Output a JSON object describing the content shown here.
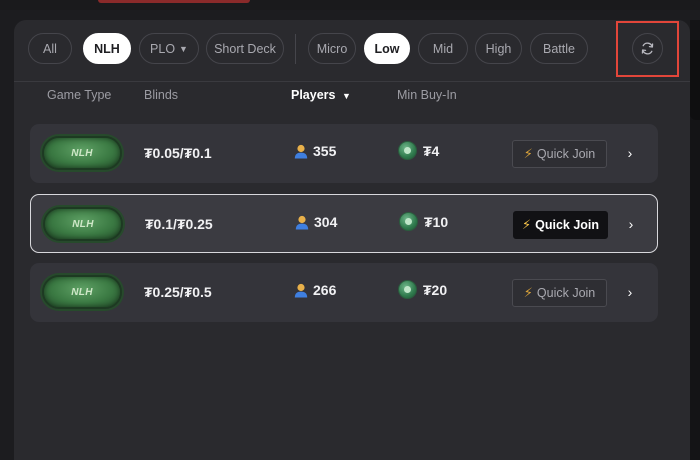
{
  "filters": {
    "game_types": [
      {
        "label": "All",
        "active": false
      },
      {
        "label": "NLH",
        "active": true
      },
      {
        "label": "PLO",
        "active": false,
        "has_dropdown": true
      },
      {
        "label": "Short Deck",
        "active": false
      }
    ],
    "stakes": [
      {
        "label": "Micro",
        "active": false
      },
      {
        "label": "Low",
        "active": true
      },
      {
        "label": "Mid",
        "active": false
      },
      {
        "label": "High",
        "active": false
      },
      {
        "label": "Battle",
        "active": false
      }
    ],
    "refresh_icon": "refresh-icon"
  },
  "columns": {
    "game_type": "Game Type",
    "blinds": "Blinds",
    "players": "Players",
    "players_sort": "descending",
    "min_buyin": "Min Buy-In"
  },
  "tables": [
    {
      "game": "NLH",
      "blinds": "₮0.05/₮0.1",
      "players": "355",
      "min_buyin": "₮4",
      "quick_join": "Quick Join",
      "selected": false
    },
    {
      "game": "NLH",
      "blinds": "₮0.1/₮0.25",
      "players": "304",
      "min_buyin": "₮10",
      "quick_join": "Quick Join",
      "selected": true
    },
    {
      "game": "NLH",
      "blinds": "₮0.25/₮0.5",
      "players": "266",
      "min_buyin": "₮20",
      "quick_join": "Quick Join",
      "selected": false
    }
  ],
  "colors": {
    "background": "#1c1c1f",
    "panel": "#2a2a2e",
    "row": "#34343a",
    "active_chip": "#ffffff",
    "accent_bolt": "#f3c14a",
    "badge_green": "#3b7a43",
    "highlight": "#e2463a"
  }
}
